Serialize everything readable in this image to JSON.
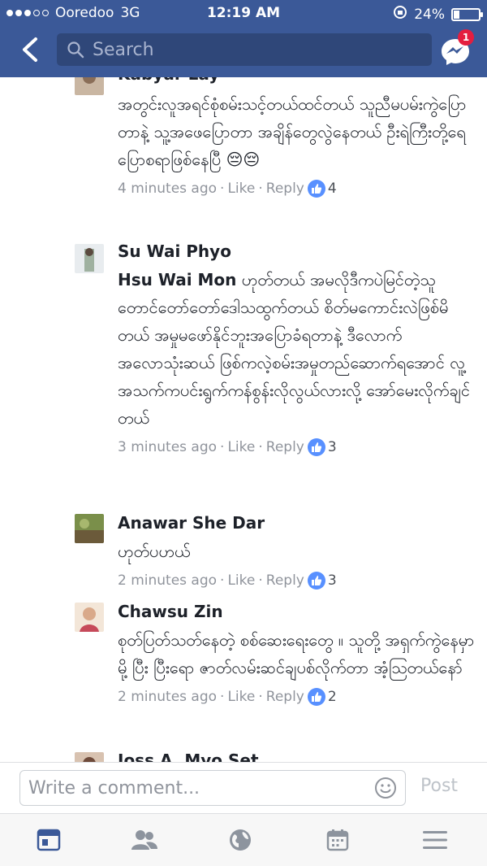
{
  "status": {
    "carrier": "Ooredoo",
    "network": "3G",
    "time": "12:19 AM",
    "battery": "24%",
    "battery_level": 0.24
  },
  "nav": {
    "search_placeholder": "Search",
    "messenger_badge": "1"
  },
  "comments": [
    {
      "name": "Kabyar Lay",
      "body": "အတွင်းလူအရင်စုံစမ်းသင့်တယ်ထင်တယ် သူညီမပမ်းကွဲပြောတာနဲ့ သူ့အဖေပြောတာ အချိန်တွေလွဲနေတယ် ဦးရဲကြီးတို့ရေ ပြောစရာဖြစ်နေပြီ 😔😔",
      "time": "4 minutes ago",
      "like": "Like",
      "reply": "Reply",
      "likes": "4"
    },
    {
      "name": "Su Wai Phyo",
      "tag": "Hsu Wai Mon",
      "body": " ဟုတ်တယ် အမလိုဒီကပဲမြင်တဲ့သူတောင်တော်တော်ဒေါသထွက်တယ် စိတ်မကောင်းလဲဖြစ်မိတယ် အမှုမဖော်နိုင်ဘူးအပြောခံရတာနဲ့ ဒီလောက်အလောသုံးဆယ် ဖြစ်ကလဲ့စမ်းအမှုတည်ဆောက်ရအောင် လူ့အသက်ကပင်းရွက်ကန်စွန်းလိုလွယ်လားလို့ အော်မေးလိုက်ချင်တယ်",
      "time": "3 minutes ago",
      "like": "Like",
      "reply": "Reply",
      "likes": "3"
    },
    {
      "name": "Anawar She Dar",
      "body": "ဟုတ်ပဟယ်",
      "time": "2 minutes ago",
      "like": "Like",
      "reply": "Reply",
      "likes": "3"
    },
    {
      "name": "Chawsu Zin",
      "body": "စုတ်ပြတ်သတ်နေတဲ့ စစ်ဆေးရေးတွေ ။ သူတို့ အရှက်ကွဲနေမှာမို့ ပြီး ပြီးရော ဇာတ်လမ်းဆင်ချပစ်လိုက်တာ အံ့ဩတယ်နော်",
      "time": "2 minutes ago",
      "like": "Like",
      "reply": "Reply",
      "likes": "2"
    },
    {
      "name": "Joss A. Myo Set"
    }
  ],
  "composer": {
    "placeholder": "Write a comment...",
    "post_label": "Post"
  },
  "tabs": [
    "news-feed",
    "friends",
    "notifications-globe",
    "events",
    "menu"
  ],
  "colors": {
    "brand": "#3b5998",
    "like_blue": "#5890ff",
    "meta_gray": "#90949c"
  }
}
